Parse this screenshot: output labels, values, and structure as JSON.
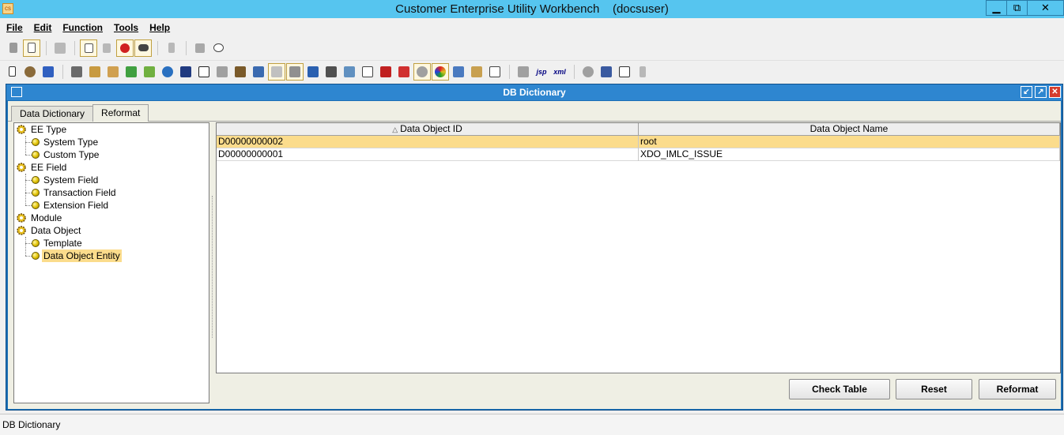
{
  "window": {
    "title": "Customer Enterprise Utility Workbench    (docsuser)",
    "app_icon_text": "cs",
    "min_glyph": "▁",
    "max_glyph": "⧉",
    "close_glyph": "✕"
  },
  "menu": [
    {
      "label": "File"
    },
    {
      "label": "Edit"
    },
    {
      "label": "Function"
    },
    {
      "label": "Tools"
    },
    {
      "label": "Help"
    }
  ],
  "toolbar2_text_icons": {
    "jsp": "jsp",
    "xml": "xml"
  },
  "internal_window": {
    "title": "DB Dictionary",
    "btn_restore": "↙",
    "btn_maximize": "↗",
    "btn_close": "✕"
  },
  "tabs": [
    {
      "label": "Data Dictionary",
      "active": false
    },
    {
      "label": "Reformat",
      "active": true
    }
  ],
  "tree": {
    "nodes": [
      {
        "label": "EE Type",
        "type": "category"
      },
      {
        "label": "System Type",
        "type": "leaf"
      },
      {
        "label": "Custom Type",
        "type": "leaf"
      },
      {
        "label": "EE Field",
        "type": "category"
      },
      {
        "label": "System Field",
        "type": "leaf"
      },
      {
        "label": "Transaction Field",
        "type": "leaf"
      },
      {
        "label": "Extension Field",
        "type": "leaf"
      },
      {
        "label": "Module",
        "type": "category"
      },
      {
        "label": "Data Object",
        "type": "category"
      },
      {
        "label": "Template",
        "type": "leaf"
      },
      {
        "label": "Data Object Entity",
        "type": "leaf",
        "selected": true
      }
    ]
  },
  "table": {
    "columns": [
      {
        "label": "Data Object ID",
        "sorted": "ascending",
        "sort_glyph": "△"
      },
      {
        "label": "Data Object Name"
      }
    ],
    "rows": [
      {
        "id": "D00000000002",
        "name": "root",
        "selected": true
      },
      {
        "id": "D00000000001",
        "name": "XDO_IMLC_ISSUE",
        "selected": false
      }
    ]
  },
  "buttons": {
    "check_table": "Check Table",
    "reset": "Reset",
    "reformat": "Reformat"
  },
  "status": {
    "text": "DB Dictionary"
  },
  "colors": {
    "title_bar": "#56c5ef",
    "internal_title": "#2e86d0",
    "selection": "#fbdc8c"
  }
}
